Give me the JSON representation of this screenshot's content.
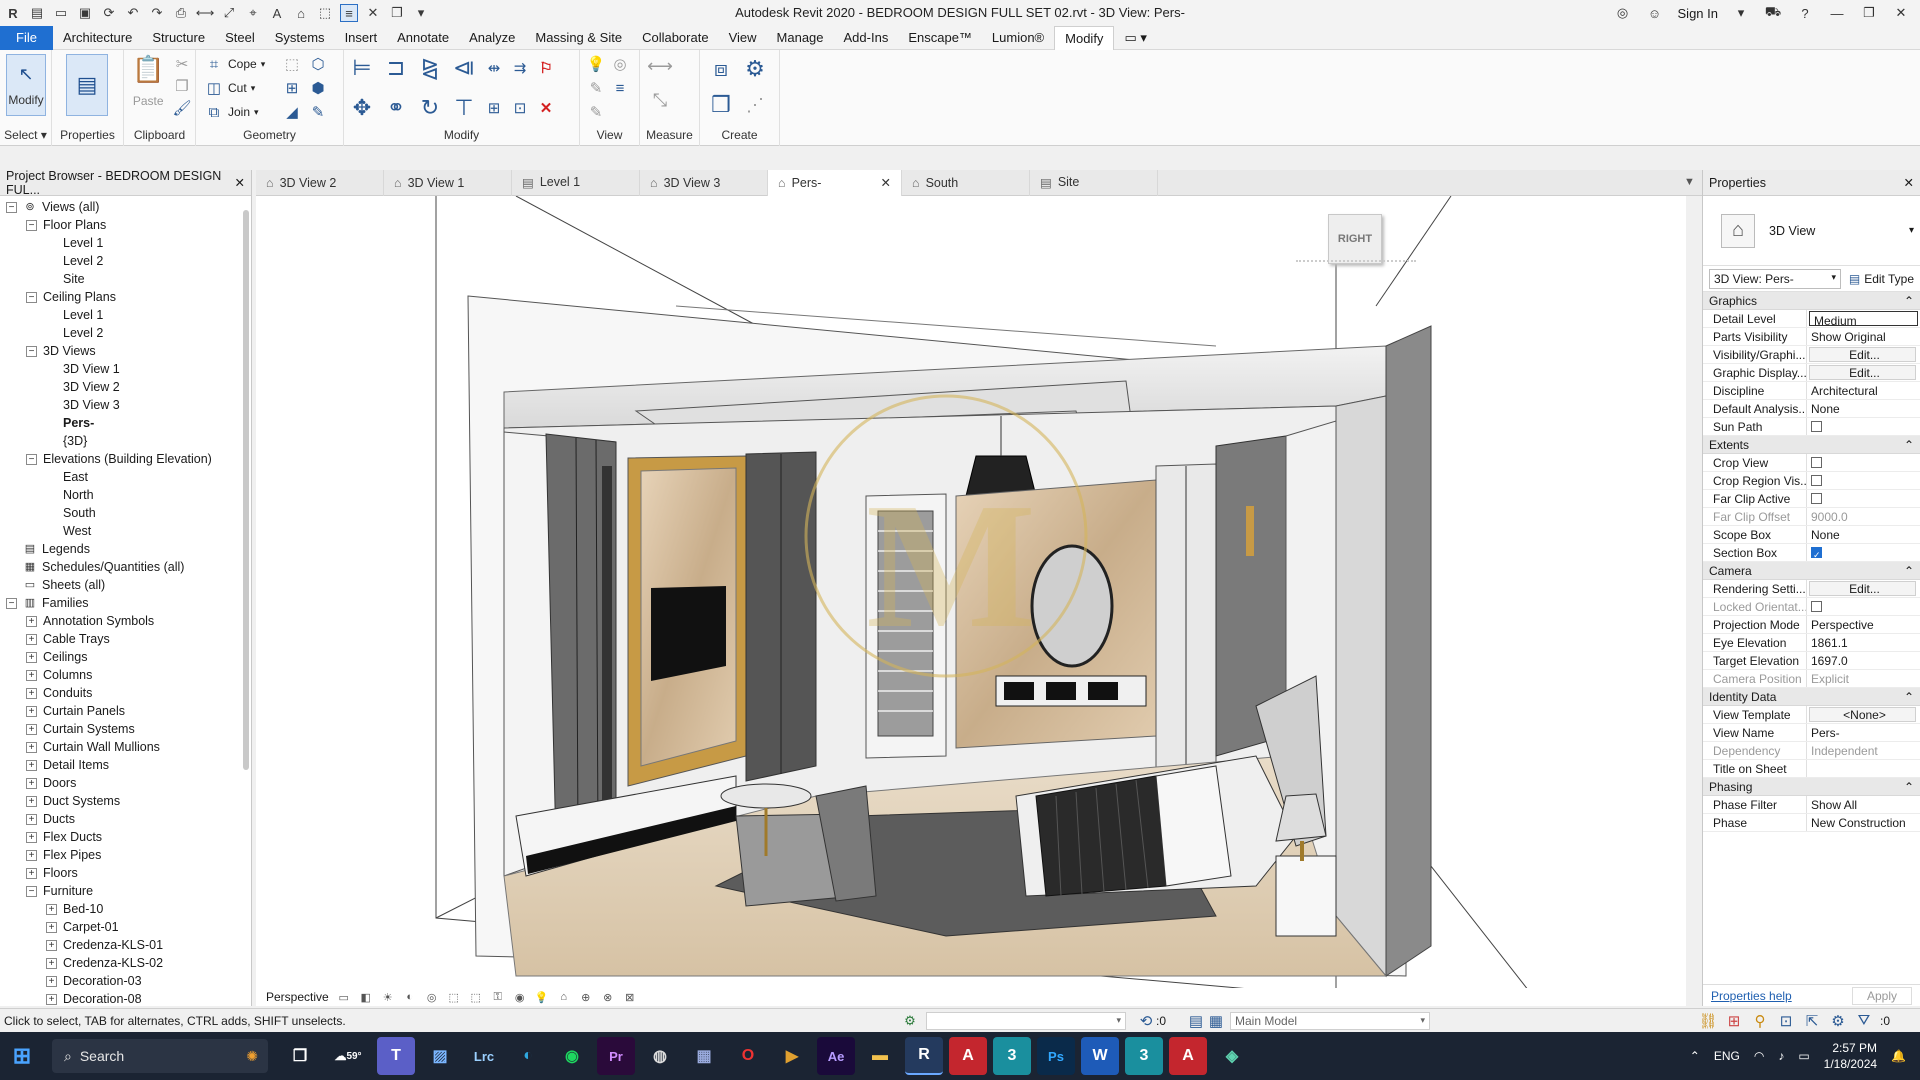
{
  "window": {
    "title": "Autodesk Revit 2020 - BEDROOM DESIGN FULL SET 02.rvt - 3D View: Pers-",
    "sign_in": "Sign In"
  },
  "menu": [
    "File",
    "Architecture",
    "Structure",
    "Steel",
    "Systems",
    "Insert",
    "Annotate",
    "Analyze",
    "Massing & Site",
    "Collaborate",
    "View",
    "Manage",
    "Add-Ins",
    "Enscape™",
    "Lumion®",
    "Modify"
  ],
  "menu_active": "Modify",
  "ribbon": {
    "select": {
      "modify_label": "Modify",
      "group_label": "Select ▾"
    },
    "properties": {
      "label": "Properties"
    },
    "clipboard": {
      "paste_label": "Paste",
      "group_label": "Clipboard"
    },
    "geometry": {
      "cope_label": "Cope",
      "cut_label": "Cut",
      "join_label": "Join",
      "group_label": "Geometry"
    },
    "modify": {
      "group_label": "Modify"
    },
    "view": {
      "group_label": "View"
    },
    "measure": {
      "group_label": "Measure"
    },
    "create": {
      "group_label": "Create"
    }
  },
  "tabs": [
    {
      "label": "3D View 2",
      "icon": "3d-view-icon"
    },
    {
      "label": "3D View 1",
      "icon": "3d-view-icon"
    },
    {
      "label": "Level 1",
      "icon": "floor-plan-icon"
    },
    {
      "label": "3D View 3",
      "icon": "3d-view-icon"
    },
    {
      "label": "Pers-",
      "icon": "3d-view-icon",
      "active": true
    },
    {
      "label": "South",
      "icon": "elevation-icon"
    },
    {
      "label": "Site",
      "icon": "floor-plan-icon"
    }
  ],
  "project_browser": {
    "title": "Project Browser - BEDROOM DESIGN FUL...",
    "tree": [
      {
        "label": "Views (all)",
        "level": 0,
        "toggle": "−",
        "icon": "⊚"
      },
      {
        "label": "Floor Plans",
        "level": 1,
        "toggle": "−"
      },
      {
        "label": "Level 1",
        "level": 2
      },
      {
        "label": "Level 2",
        "level": 2
      },
      {
        "label": "Site",
        "level": 2
      },
      {
        "label": "Ceiling Plans",
        "level": 1,
        "toggle": "−"
      },
      {
        "label": "Level 1",
        "level": 2
      },
      {
        "label": "Level 2",
        "level": 2
      },
      {
        "label": "3D Views",
        "level": 1,
        "toggle": "−"
      },
      {
        "label": "3D View 1",
        "level": 2
      },
      {
        "label": "3D View 2",
        "level": 2
      },
      {
        "label": "3D View 3",
        "level": 2
      },
      {
        "label": "Pers-",
        "level": 2,
        "bold": true
      },
      {
        "label": "{3D}",
        "level": 2
      },
      {
        "label": "Elevations (Building Elevation)",
        "level": 1,
        "toggle": "−"
      },
      {
        "label": "East",
        "level": 2
      },
      {
        "label": "North",
        "level": 2
      },
      {
        "label": "South",
        "level": 2
      },
      {
        "label": "West",
        "level": 2
      },
      {
        "label": "Legends",
        "level": 0,
        "icon": "▤"
      },
      {
        "label": "Schedules/Quantities (all)",
        "level": 0,
        "icon": "▦"
      },
      {
        "label": "Sheets (all)",
        "level": 0,
        "icon": "▭"
      },
      {
        "label": "Families",
        "level": 0,
        "toggle": "−",
        "icon": "▥"
      },
      {
        "label": "Annotation Symbols",
        "level": 1,
        "toggle": "+"
      },
      {
        "label": "Cable Trays",
        "level": 1,
        "toggle": "+"
      },
      {
        "label": "Ceilings",
        "level": 1,
        "toggle": "+"
      },
      {
        "label": "Columns",
        "level": 1,
        "toggle": "+"
      },
      {
        "label": "Conduits",
        "level": 1,
        "toggle": "+"
      },
      {
        "label": "Curtain Panels",
        "level": 1,
        "toggle": "+"
      },
      {
        "label": "Curtain Systems",
        "level": 1,
        "toggle": "+"
      },
      {
        "label": "Curtain Wall Mullions",
        "level": 1,
        "toggle": "+"
      },
      {
        "label": "Detail Items",
        "level": 1,
        "toggle": "+"
      },
      {
        "label": "Doors",
        "level": 1,
        "toggle": "+"
      },
      {
        "label": "Duct Systems",
        "level": 1,
        "toggle": "+"
      },
      {
        "label": "Ducts",
        "level": 1,
        "toggle": "+"
      },
      {
        "label": "Flex Ducts",
        "level": 1,
        "toggle": "+"
      },
      {
        "label": "Flex Pipes",
        "level": 1,
        "toggle": "+"
      },
      {
        "label": "Floors",
        "level": 1,
        "toggle": "+"
      },
      {
        "label": "Furniture",
        "level": 1,
        "toggle": "−"
      },
      {
        "label": "Bed-10",
        "level": 2,
        "toggle": "+"
      },
      {
        "label": "Carpet-01",
        "level": 2,
        "toggle": "+"
      },
      {
        "label": "Credenza-KLS-01",
        "level": 2,
        "toggle": "+"
      },
      {
        "label": "Credenza-KLS-02",
        "level": 2,
        "toggle": "+"
      },
      {
        "label": "Decoration-03",
        "level": 2,
        "toggle": "+"
      },
      {
        "label": "Decoration-08",
        "level": 2,
        "toggle": "+"
      }
    ]
  },
  "viewport": {
    "viewcube_label": "RIGHT",
    "view_scale": "Perspective"
  },
  "properties": {
    "title": "Properties",
    "type_name": "3D View",
    "instance_selector": "3D View: Pers-",
    "edit_type": "Edit Type",
    "categories": [
      {
        "name": "Graphics",
        "rows": [
          {
            "key": "Detail Level",
            "value": "Medium",
            "kind": "box"
          },
          {
            "key": "Parts Visibility",
            "value": "Show Original"
          },
          {
            "key": "Visibility/Graphi...",
            "value": "Edit...",
            "kind": "btn"
          },
          {
            "key": "Graphic Display...",
            "value": "Edit...",
            "kind": "btn"
          },
          {
            "key": "Discipline",
            "value": "Architectural"
          },
          {
            "key": "Default Analysis...",
            "value": "None"
          },
          {
            "key": "Sun Path",
            "value": "",
            "kind": "check"
          }
        ]
      },
      {
        "name": "Extents",
        "rows": [
          {
            "key": "Crop View",
            "value": "",
            "kind": "check"
          },
          {
            "key": "Crop Region Vis...",
            "value": "",
            "kind": "check"
          },
          {
            "key": "Far Clip Active",
            "value": "",
            "kind": "check"
          },
          {
            "key": "Far Clip Offset",
            "value": "9000.0",
            "disabled": true
          },
          {
            "key": "Scope Box",
            "value": "None"
          },
          {
            "key": "Section Box",
            "value": "",
            "kind": "check-on"
          }
        ]
      },
      {
        "name": "Camera",
        "rows": [
          {
            "key": "Rendering Setti...",
            "value": "Edit...",
            "kind": "btn"
          },
          {
            "key": "Locked Orientat...",
            "value": "",
            "kind": "check",
            "disabled": true
          },
          {
            "key": "Projection Mode",
            "value": "Perspective"
          },
          {
            "key": "Eye Elevation",
            "value": "1861.1"
          },
          {
            "key": "Target Elevation",
            "value": "1697.0"
          },
          {
            "key": "Camera Position",
            "value": "Explicit",
            "disabled": true
          }
        ]
      },
      {
        "name": "Identity Data",
        "rows": [
          {
            "key": "View Template",
            "value": "<None>",
            "kind": "btn"
          },
          {
            "key": "View Name",
            "value": "Pers-"
          },
          {
            "key": "Dependency",
            "value": "Independent",
            "disabled": true
          },
          {
            "key": "Title on Sheet",
            "value": ""
          }
        ]
      },
      {
        "name": "Phasing",
        "rows": [
          {
            "key": "Phase Filter",
            "value": "Show All"
          },
          {
            "key": "Phase",
            "value": "New Construction"
          }
        ]
      }
    ],
    "help_link": "Properties help",
    "apply": "Apply"
  },
  "status": {
    "hint": "Click to select, TAB for alternates, CTRL adds, SHIFT unselects.",
    "count": ":0",
    "model": "Main Model",
    "filter_count": ":0"
  },
  "taskbar": {
    "search": "Search",
    "weather": "59°",
    "lang": "ENG",
    "time": "2:57 PM",
    "date": "1/18/2024"
  }
}
